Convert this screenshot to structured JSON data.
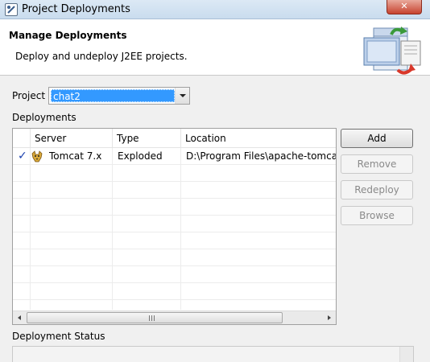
{
  "window": {
    "title": "Project Deployments",
    "close_glyph": "✕"
  },
  "header": {
    "title": "Manage Deployments",
    "description": "Deploy and undeploy J2EE projects.",
    "icon": "deployment-banner-icon"
  },
  "project": {
    "label": "Project",
    "selected": "chat2"
  },
  "deployments": {
    "label": "Deployments",
    "columns": [
      "Server",
      "Type",
      "Location"
    ],
    "rows": [
      {
        "status_icon": "checkmark-icon",
        "server_icon": "tomcat-icon",
        "server": "Tomcat  7.x",
        "type": "Exploded",
        "location": "D:\\Program Files\\apache-tomca"
      }
    ],
    "check_glyph": "✓",
    "check_color": "#1a3fae"
  },
  "buttons": {
    "add": "Add",
    "remove": "Remove",
    "redeploy": "Redeploy",
    "browse": "Browse"
  },
  "status": {
    "label": "Deployment Status"
  }
}
